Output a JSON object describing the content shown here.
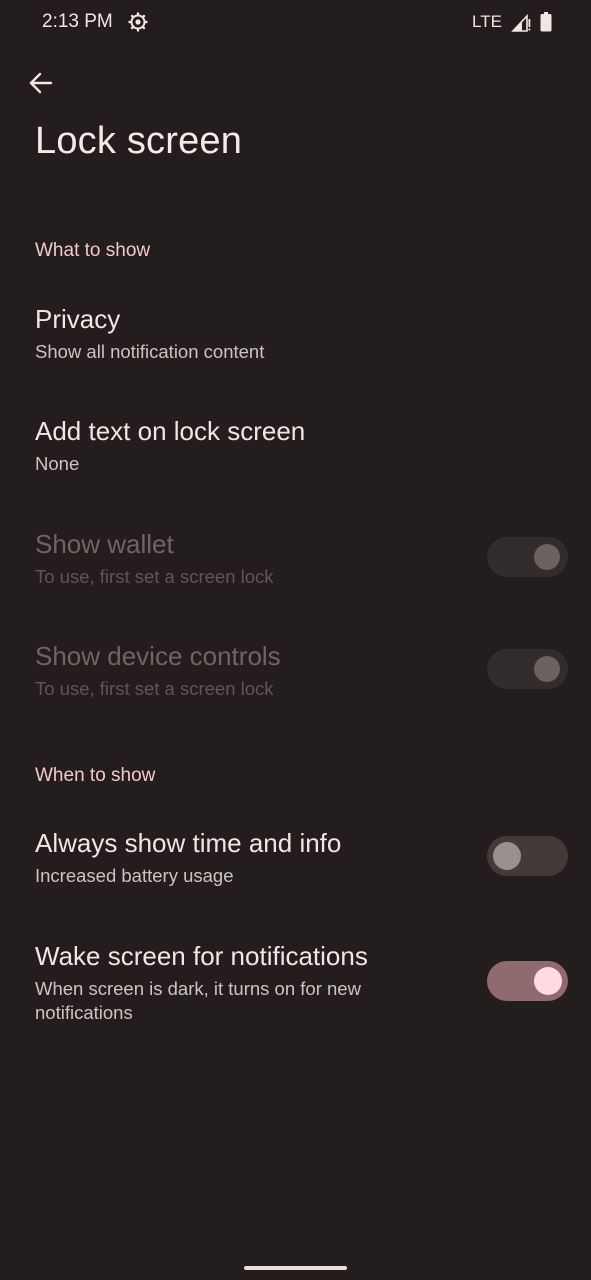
{
  "status_bar": {
    "time": "2:13 PM",
    "settings_icon": "gear-icon",
    "network": "LTE",
    "signal_icon": "signal-icon",
    "battery_icon": "battery-icon"
  },
  "toolbar": {
    "back_icon": "arrow-back-icon",
    "title": "Lock screen"
  },
  "sections": {
    "what_to_show": {
      "header": "What to show",
      "items": [
        {
          "title": "Privacy",
          "summary": "Show all notification content"
        },
        {
          "title": "Add text on lock screen",
          "summary": "None"
        },
        {
          "title": "Show wallet",
          "summary": "To use, first set a screen lock",
          "toggle": "off",
          "enabled": false
        },
        {
          "title": "Show device controls",
          "summary": "To use, first set a screen lock",
          "toggle": "off",
          "enabled": false
        }
      ]
    },
    "when_to_show": {
      "header": "When to show",
      "items": [
        {
          "title": "Always show time and info",
          "summary": "Increased battery usage",
          "toggle": "off",
          "enabled": true
        },
        {
          "title": "Wake screen for notifications",
          "summary": "When screen is dark, it turns on for new notifications",
          "toggle": "on",
          "enabled": true
        }
      ]
    }
  },
  "colors": {
    "background": "#231d1d",
    "accent": "#f3c8cf",
    "toggle_on_track": "#8f6a6f",
    "toggle_on_thumb": "#ffdce2"
  }
}
